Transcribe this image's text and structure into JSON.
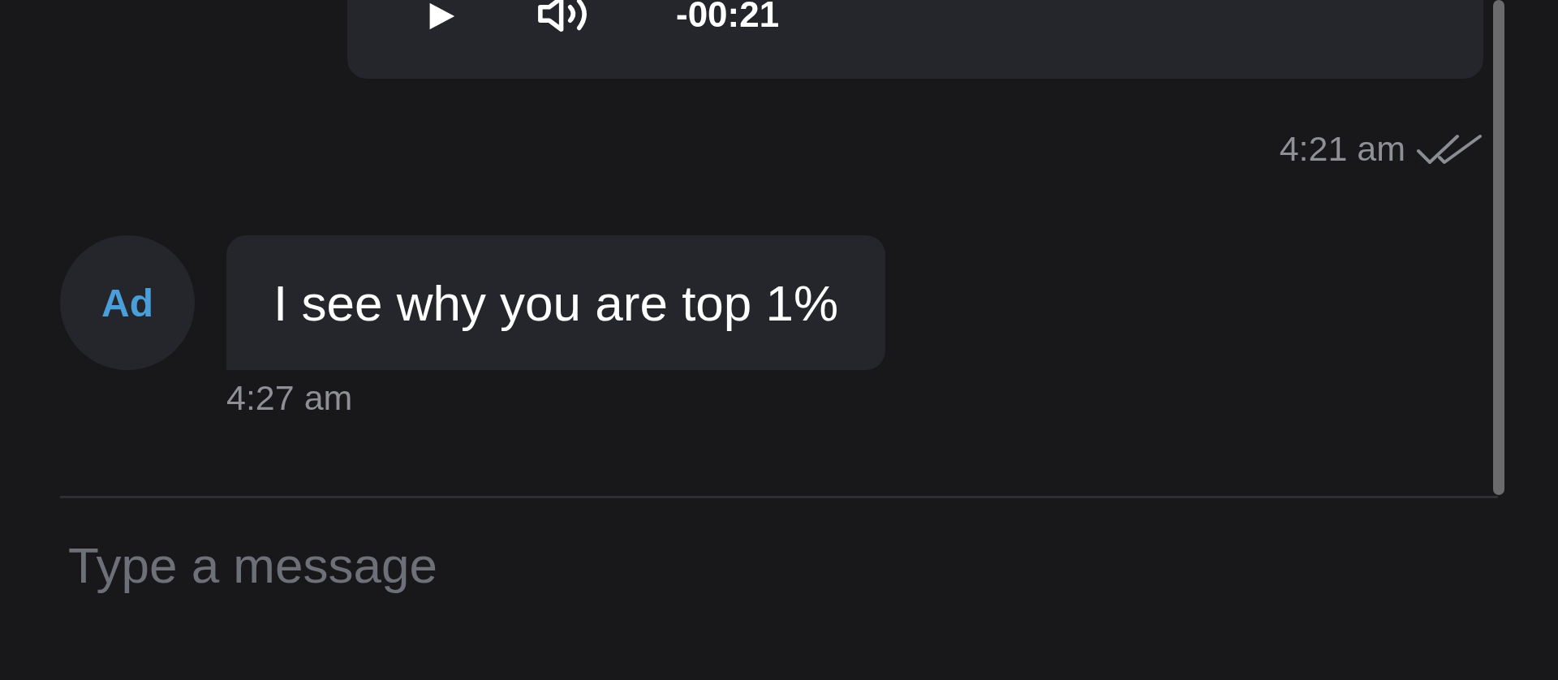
{
  "messages": [
    {
      "kind": "audio",
      "outgoing": true,
      "remaining": "-00:21",
      "time": "4:21 am",
      "read": true
    },
    {
      "kind": "text",
      "outgoing": false,
      "avatar": "Ad",
      "text": "I see why you are top 1%",
      "time": "4:27 am"
    }
  ],
  "composer": {
    "placeholder": "Type a message"
  }
}
